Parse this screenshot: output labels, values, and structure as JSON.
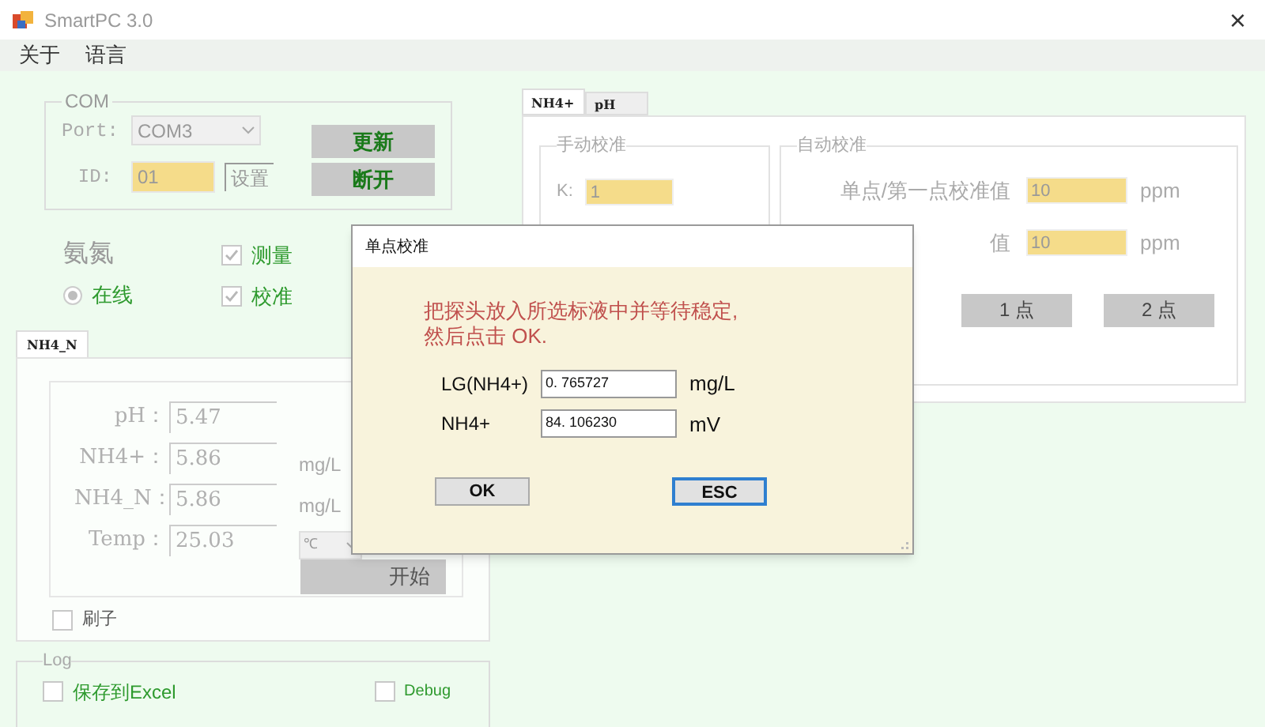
{
  "window": {
    "title": "SmartPC 3.0",
    "close": "×"
  },
  "menu": [
    "关于",
    "语言"
  ],
  "com_group": {
    "title": "COM",
    "port_label": "Port:",
    "port_value": "COM3",
    "id_label": "ID:",
    "id_value": "01",
    "set_button": "设置",
    "buttons": [
      "更新",
      "断开"
    ]
  },
  "mode": {
    "title": "氨氮",
    "radio": {
      "label": "在线",
      "selected": true
    },
    "checks": [
      {
        "label": "测量",
        "checked": true
      },
      {
        "label": "校准",
        "checked": true
      }
    ]
  },
  "left_tabs": [
    {
      "label": "NH4_N",
      "selected": true
    }
  ],
  "readings": [
    {
      "kind": "plain",
      "label": "pH：",
      "value": "5.47"
    },
    {
      "kind": "unit",
      "label": "NH4+：",
      "value": "5.86",
      "unit": "mg/L"
    },
    {
      "kind": "unit",
      "label": "NH4_N：",
      "value": "5.86",
      "unit": "mg/L"
    },
    {
      "kind": "select",
      "label": "Temp：",
      "value": "25.03",
      "unit": "℃"
    }
  ],
  "start_button": "开始",
  "brush": {
    "label": "刷子",
    "checked": false
  },
  "log": {
    "title": "Log",
    "checks": [
      {
        "label": "保存到Excel",
        "checked": false
      },
      {
        "label": "Debug",
        "checked": false
      }
    ]
  },
  "right_tabs": [
    {
      "label": "NH4+",
      "selected": true
    },
    {
      "label": "pH",
      "selected": false
    }
  ],
  "manual": {
    "title": "手动校准",
    "k_label": "K:",
    "k_value": "1"
  },
  "auto": {
    "title": "自动校准",
    "rows": [
      {
        "label": "单点/第一点校准值",
        "value": "10",
        "unit": "ppm"
      },
      {
        "label": "值",
        "value": "10",
        "unit": "ppm"
      }
    ],
    "buttons": [
      "1 点",
      "2 点"
    ]
  },
  "dialog": {
    "title": "单点校准",
    "message": [
      "把探头放入所选标液中并等待稳定,",
      "然后点击 OK."
    ],
    "fields": [
      {
        "label": "LG(NH4+)",
        "value": "0. 765727",
        "unit": "mg/L"
      },
      {
        "label": "NH4+",
        "value": "84. 106230",
        "unit": "mV"
      }
    ],
    "buttons": [
      {
        "label": "OK",
        "focused": false
      },
      {
        "label": "ESC",
        "focused": true
      }
    ]
  }
}
